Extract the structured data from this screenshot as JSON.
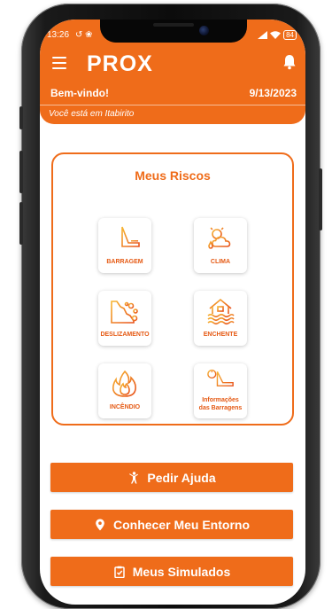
{
  "status": {
    "time": "13:26",
    "battery": "84"
  },
  "app": {
    "logo": "PROX"
  },
  "header": {
    "welcome": "Bem-vindo!",
    "date": "9/13/2023",
    "location": "Você está em Itabirito"
  },
  "risks": {
    "title": "Meus Riscos",
    "items": [
      {
        "label": "BARRAGEM",
        "icon": "dam-icon"
      },
      {
        "label": "CLIMA",
        "icon": "weather-icon"
      },
      {
        "label": "DESLIZAMENTO",
        "icon": "landslide-icon"
      },
      {
        "label": "ENCHENTE",
        "icon": "flood-icon"
      },
      {
        "label": "INCÊNDIO",
        "icon": "fire-icon"
      },
      {
        "label_line1": "Informações",
        "label_line2": "das Barragens",
        "icon": "dam-info-icon"
      }
    ]
  },
  "actions": [
    {
      "label": "Pedir Ajuda",
      "icon": "help-person-icon"
    },
    {
      "label": "Conhecer Meu Entorno",
      "icon": "location-pin-icon"
    },
    {
      "label": "Meus Simulados",
      "icon": "clipboard-icon"
    }
  ],
  "colors": {
    "primary": "#ef6c1a",
    "icon_gradient_start": "#f7b733",
    "icon_gradient_end": "#e8501a"
  }
}
